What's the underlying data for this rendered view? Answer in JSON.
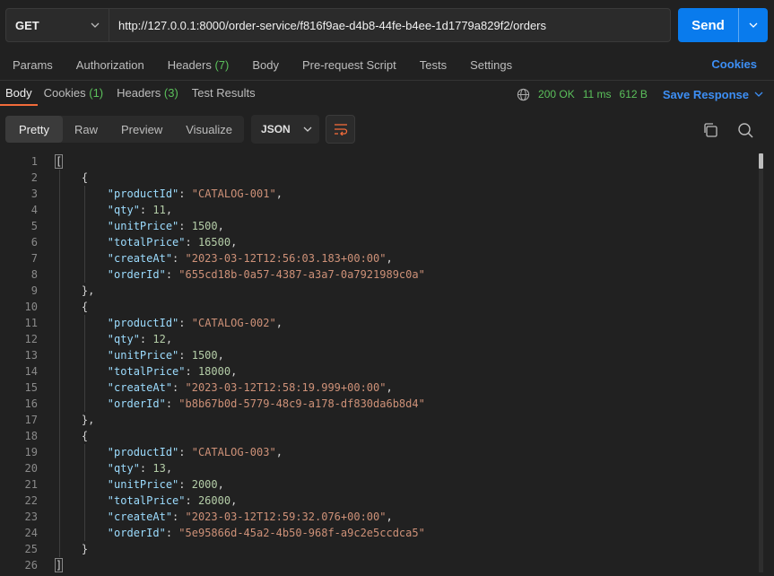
{
  "request": {
    "method": "GET",
    "url": "http://127.0.0.1:8000/order-service/f816f9ae-d4b8-44fe-b4ee-1d1779a829f2/orders",
    "send_label": "Send"
  },
  "request_tabs": [
    {
      "label": "Params",
      "count": ""
    },
    {
      "label": "Authorization",
      "count": ""
    },
    {
      "label": "Headers",
      "count": "(7)"
    },
    {
      "label": "Body",
      "count": ""
    },
    {
      "label": "Pre-request Script",
      "count": ""
    },
    {
      "label": "Tests",
      "count": ""
    },
    {
      "label": "Settings",
      "count": ""
    }
  ],
  "cookies_link": "Cookies",
  "response_tabs": [
    {
      "label": "Body",
      "count": ""
    },
    {
      "label": "Cookies",
      "count": "(1)"
    },
    {
      "label": "Headers",
      "count": "(3)"
    },
    {
      "label": "Test Results",
      "count": ""
    }
  ],
  "status": {
    "code": "200 OK",
    "time": "11 ms",
    "size": "612 B"
  },
  "save_response": "Save Response",
  "view_modes": [
    "Pretty",
    "Raw",
    "Preview",
    "Visualize"
  ],
  "format": "JSON",
  "orders": [
    {
      "productId": "CATALOG-001",
      "qty": "11",
      "unitPrice": "1500",
      "totalPrice": "16500",
      "createAt": "2023-03-12T12:56:03.183+00:00",
      "orderId": "655cd18b-0a57-4387-a3a7-0a7921989c0a"
    },
    {
      "productId": "CATALOG-002",
      "qty": "12",
      "unitPrice": "1500",
      "totalPrice": "18000",
      "createAt": "2023-03-12T12:58:19.999+00:00",
      "orderId": "b8b67b0d-5779-48c9-a178-df830da6b8d4"
    },
    {
      "productId": "CATALOG-003",
      "qty": "13",
      "unitPrice": "2000",
      "totalPrice": "26000",
      "createAt": "2023-03-12T12:59:32.076+00:00",
      "orderId": "5e95866d-45a2-4b50-968f-a9c2e5ccdca5"
    }
  ],
  "colors": {
    "accent": "#097bed",
    "link": "#3d8ff5",
    "success": "#5bc05b",
    "active_tab": "#f26b3a"
  }
}
